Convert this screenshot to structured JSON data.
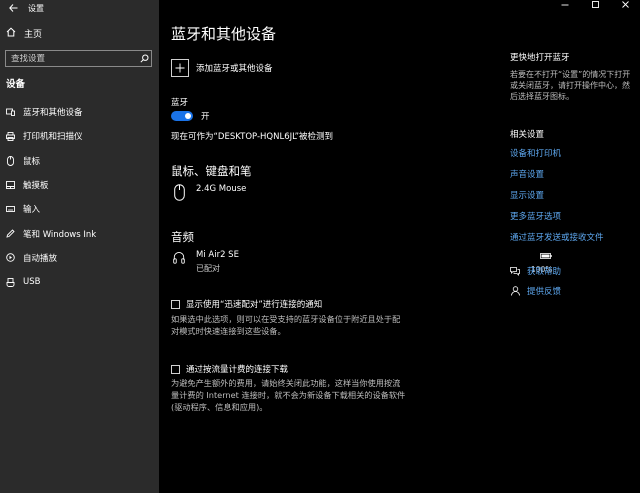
{
  "app": {
    "title": "设置",
    "home_label": "主页",
    "search_placeholder": "查找设置",
    "section_title": "设备"
  },
  "sidebar": {
    "items": [
      {
        "label": "蓝牙和其他设备",
        "icon": "bluetooth-devices-icon"
      },
      {
        "label": "打印机和扫描仪",
        "icon": "printer-icon"
      },
      {
        "label": "鼠标",
        "icon": "mouse-icon"
      },
      {
        "label": "触摸板",
        "icon": "touchpad-icon"
      },
      {
        "label": "输入",
        "icon": "keyboard-icon"
      },
      {
        "label": "笔和 Windows Ink",
        "icon": "pen-icon"
      },
      {
        "label": "自动播放",
        "icon": "autoplay-icon"
      },
      {
        "label": "USB",
        "icon": "usb-icon"
      }
    ]
  },
  "main": {
    "title": "蓝牙和其他设备",
    "add_device_label": "添加蓝牙或其他设备",
    "bluetooth_label": "蓝牙",
    "bluetooth_state": "开",
    "discoverable_text": "现在可作为“DESKTOP-HQNL6JL”被检测到",
    "mouse_section": {
      "title": "鼠标、键盘和笔",
      "devices": [
        {
          "name": "2.4G Mouse"
        }
      ]
    },
    "audio_section": {
      "title": "音频",
      "devices": [
        {
          "name": "Mi Air2 SE",
          "status": "已配对",
          "battery": "100%",
          "battery_level": 1.0
        }
      ]
    },
    "swift_pair": {
      "label": "显示使用“迅速配对”进行连接的通知",
      "description": "如果选中此选项，则可以在受支持的蓝牙设备位于附近且处于配对模式时快速连接到这些设备。",
      "checked": false
    },
    "metered": {
      "label": "通过按流量计费的连接下载",
      "description": "为避免产生额外的费用，请始终关闭此功能，这样当你使用按流量计费的 Internet 连接时，就不会为新设备下载相关的设备软件(驱动程序、信息和应用)。",
      "checked": false
    }
  },
  "right": {
    "faster_title": "更快地打开蓝牙",
    "faster_text": "若要在不打开“设置”的情况下打开或关闭蓝牙，请打开操作中心，然后选择蓝牙图标。",
    "related_title": "相关设置",
    "links": [
      "设备和打印机",
      "声音设置",
      "显示设置",
      "更多蓝牙选项",
      "通过蓝牙发送或接收文件"
    ],
    "help_label": "获取帮助",
    "feedback_label": "提供反馈"
  },
  "colors": {
    "accent": "#1a73e8",
    "link": "#5ea8f0",
    "sidebar_bg": "#2b2b2b",
    "main_bg": "#000000"
  }
}
